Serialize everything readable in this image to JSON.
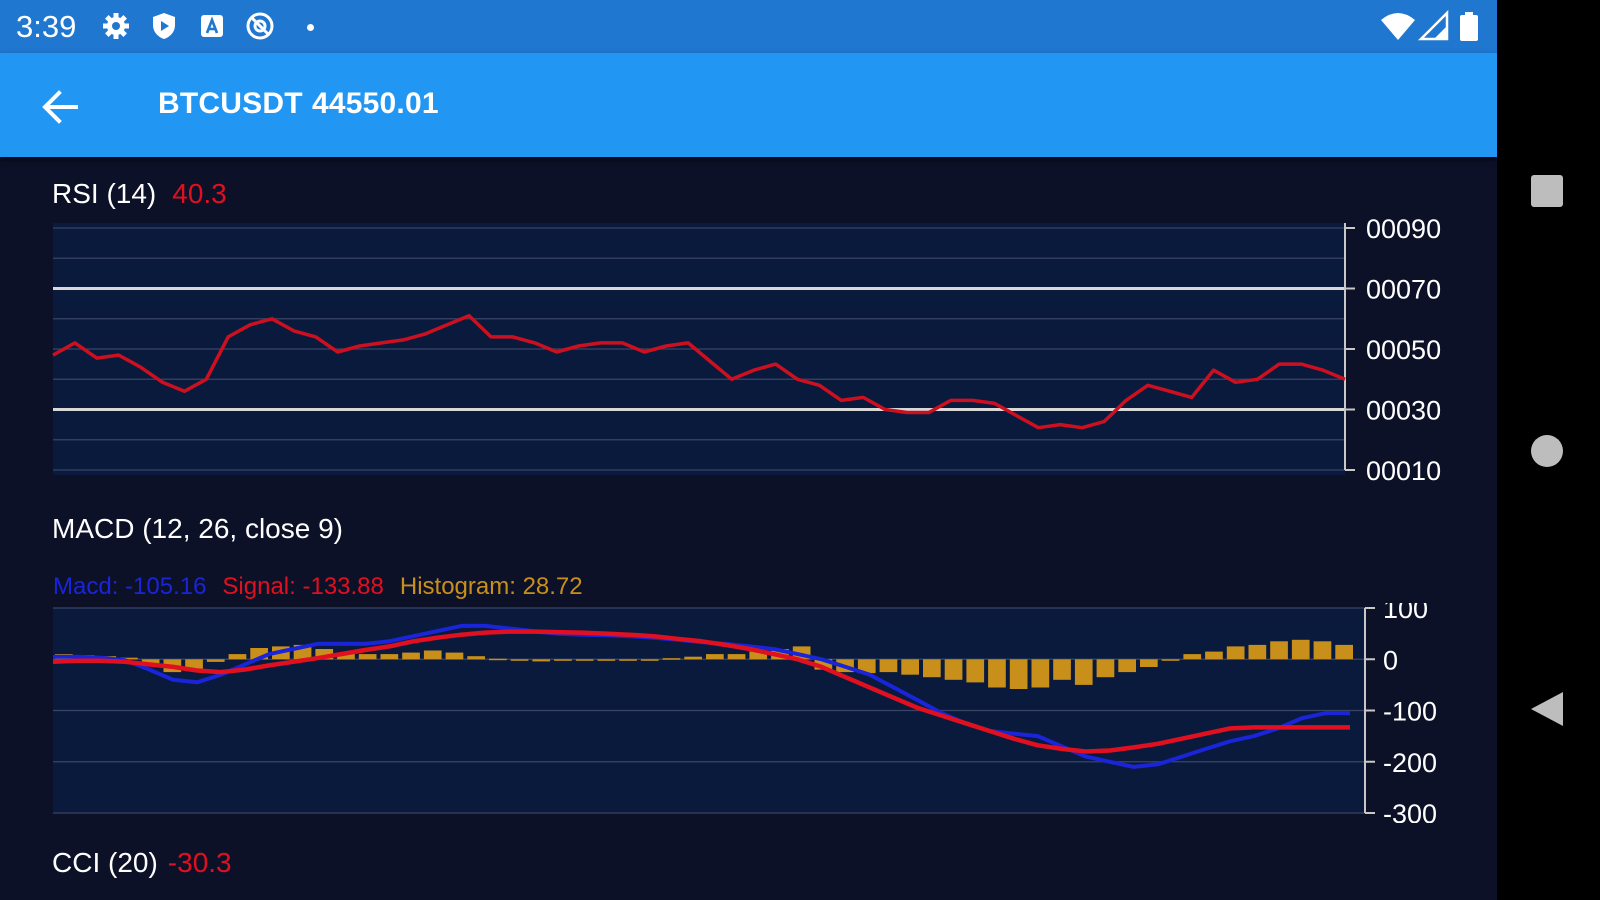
{
  "status_bar": {
    "time": "3:39",
    "icons": [
      "settings-icon",
      "shield-play-icon",
      "a-box-icon",
      "at-sign-icon",
      "dot-icon"
    ],
    "right_icons": [
      "wifi-icon",
      "signal-icon",
      "battery-icon"
    ]
  },
  "app_bar": {
    "back_icon": "arrow-back-icon",
    "symbol": "BTCUSDT",
    "price": "44550.01"
  },
  "rsi": {
    "title": "RSI (14)",
    "value": "40.3",
    "axis_labels": [
      "00090",
      "00070",
      "00050",
      "00030",
      "00010"
    ],
    "colors": {
      "line": "#cc1020",
      "threshold": "#d8d8d8",
      "grid": "#3a4564"
    }
  },
  "macd": {
    "title": "MACD (12, 26, close 9)",
    "macd_label": "Macd: -105.16",
    "signal_label": "Signal: -133.88",
    "histogram_label": "Histogram: 28.72",
    "axis_labels": [
      "100",
      "0",
      "-100",
      "-200",
      "-300"
    ],
    "colors": {
      "macd": "#1a24d8",
      "signal": "#e01020",
      "histogram": "#c8901a"
    }
  },
  "cci": {
    "title": "CCI (20)",
    "value": "-30.3"
  },
  "nav_bar": {
    "icons": [
      "recents-square-icon",
      "home-circle-icon",
      "back-triangle-icon"
    ]
  },
  "chart_data": [
    {
      "type": "line",
      "title": "RSI (14)",
      "ylim": [
        10,
        90
      ],
      "yticks": [
        90,
        70,
        50,
        30,
        10
      ],
      "thresholds": [
        70,
        30
      ],
      "series": [
        {
          "values": [
            48,
            52,
            47,
            48,
            44,
            39,
            36,
            40,
            54,
            58,
            60,
            56,
            54,
            49,
            51,
            52,
            53,
            55,
            58,
            61,
            54,
            54,
            52,
            49,
            51,
            52,
            52,
            49,
            51,
            52,
            46,
            40,
            43,
            45,
            40,
            38,
            33,
            34,
            30,
            29,
            29,
            33,
            33,
            32,
            28,
            24,
            25,
            24,
            26,
            33,
            38,
            36,
            34,
            43,
            39,
            40,
            45,
            45,
            43,
            40
          ]
        }
      ]
    },
    {
      "type": "bar",
      "title": "MACD (12, 26, close 9)",
      "ylim": [
        -300,
        100
      ],
      "yticks": [
        100,
        0,
        -100,
        -200,
        -300
      ],
      "series": [
        {
          "name": "Macd",
          "values": [
            5,
            5,
            3,
            -2,
            -20,
            -40,
            -45,
            -30,
            -10,
            10,
            20,
            30,
            30,
            30,
            35,
            45,
            55,
            65,
            65,
            60,
            55,
            50,
            48,
            47,
            45,
            42,
            38,
            33,
            30,
            25,
            20,
            10,
            0,
            -15,
            -30,
            -55,
            -80,
            -105,
            -125,
            -140,
            -145,
            -150,
            -170,
            -190,
            -200,
            -210,
            -205,
            -190,
            -175,
            -160,
            -150,
            -135,
            -115,
            -105,
            -105
          ]
        },
        {
          "name": "Signal",
          "values": [
            -5,
            -3,
            -3,
            -5,
            -10,
            -15,
            -22,
            -25,
            -20,
            -12,
            -5,
            2,
            10,
            18,
            25,
            35,
            42,
            48,
            52,
            54,
            54,
            53,
            52,
            50,
            48,
            45,
            40,
            35,
            28,
            20,
            10,
            0,
            -15,
            -35,
            -55,
            -75,
            -95,
            -110,
            -125,
            -140,
            -155,
            -168,
            -175,
            -180,
            -178,
            -172,
            -165,
            -155,
            -145,
            -135,
            -133,
            -133,
            -133,
            -133,
            -133
          ]
        },
        {
          "name": "Histogram",
          "values": [
            10,
            8,
            6,
            3,
            -10,
            -25,
            -23,
            -5,
            10,
            22,
            25,
            28,
            20,
            12,
            10,
            10,
            13,
            17,
            13,
            6,
            1,
            -3,
            -4,
            -3,
            -3,
            -3,
            -2,
            -2,
            2,
            5,
            10,
            10,
            15,
            20,
            25,
            -20,
            -25,
            -27,
            -25,
            -30,
            -35,
            -40,
            -45,
            -55,
            -58,
            -55,
            -40,
            -50,
            -35,
            -25,
            -15,
            0,
            10,
            15,
            25,
            28,
            35,
            38,
            35,
            28
          ]
        }
      ]
    }
  ]
}
